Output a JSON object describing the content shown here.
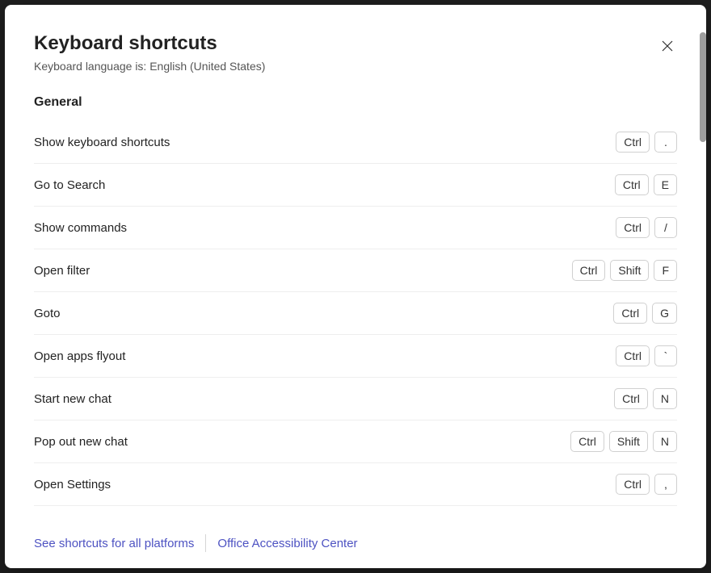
{
  "title": "Keyboard shortcuts",
  "subtitle": "Keyboard language is: English (United States)",
  "section": "General",
  "shortcuts": [
    {
      "label": "Show keyboard shortcuts",
      "keys": [
        "Ctrl",
        "."
      ]
    },
    {
      "label": "Go to Search",
      "keys": [
        "Ctrl",
        "E"
      ]
    },
    {
      "label": "Show commands",
      "keys": [
        "Ctrl",
        "/"
      ]
    },
    {
      "label": "Open filter",
      "keys": [
        "Ctrl",
        "Shift",
        "F"
      ]
    },
    {
      "label": "Goto",
      "keys": [
        "Ctrl",
        "G"
      ]
    },
    {
      "label": "Open apps flyout",
      "keys": [
        "Ctrl",
        "`"
      ]
    },
    {
      "label": "Start new chat",
      "keys": [
        "Ctrl",
        "N"
      ]
    },
    {
      "label": "Pop out new chat",
      "keys": [
        "Ctrl",
        "Shift",
        "N"
      ]
    },
    {
      "label": "Open Settings",
      "keys": [
        "Ctrl",
        ","
      ]
    }
  ],
  "footer": {
    "link_all_platforms": "See shortcuts for all platforms",
    "link_accessibility": "Office Accessibility Center"
  }
}
